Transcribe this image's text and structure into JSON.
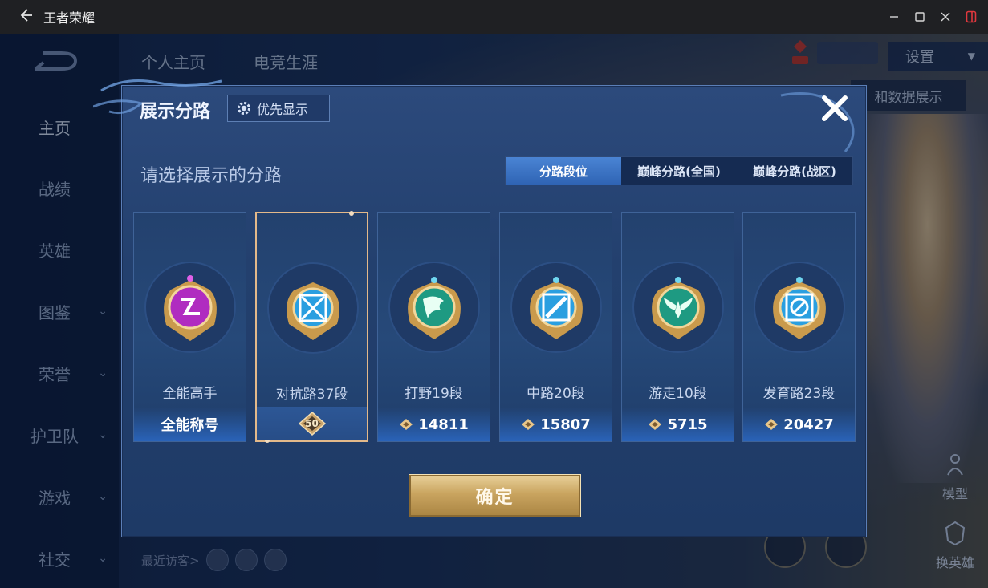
{
  "window": {
    "title": "王者荣耀",
    "back_icon": "arrow-left-icon",
    "controls": [
      "minimize-icon",
      "maximize-icon",
      "close-icon",
      "sidebar-toggle-icon"
    ],
    "accent_color": "#e0383e"
  },
  "left_nav": {
    "items": [
      {
        "label": "主页",
        "active": true,
        "chevron": false
      },
      {
        "label": "战绩",
        "active": false,
        "chevron": false
      },
      {
        "label": "英雄",
        "active": false,
        "chevron": false
      },
      {
        "label": "图鉴",
        "active": false,
        "chevron": true
      },
      {
        "label": "荣誉",
        "active": false,
        "chevron": true
      },
      {
        "label": "护卫队",
        "active": false,
        "chevron": true
      },
      {
        "label": "游戏",
        "active": false,
        "chevron": true
      },
      {
        "label": "社交",
        "active": false,
        "chevron": true
      }
    ]
  },
  "top_nav": {
    "tabs": [
      "个人主页",
      "电竞生涯"
    ],
    "settings_label": "设置",
    "right_banner": "和数据展示"
  },
  "side_buttons": {
    "model_label": "模型",
    "switch_hero_label": "换英雄"
  },
  "visitors": {
    "label": "最近访客>"
  },
  "modal": {
    "title": "展示分路",
    "priority_button": "优先显示",
    "prompt": "请选择展示的分路",
    "tabs": [
      {
        "label": "分路段位",
        "active": true
      },
      {
        "label": "巅峰分路(全国)",
        "active": false
      },
      {
        "label": "巅峰分路(战区)",
        "active": false
      }
    ],
    "cards": [
      {
        "lane": "全能高手",
        "footer": "全能称号",
        "score_icon": false,
        "selected": false,
        "medal_color": "#b02cc0",
        "emblem": "allround"
      },
      {
        "lane": "对抗路37段",
        "footer": "50",
        "score_icon": false,
        "selected": true,
        "medal_color": "#2a9fe0",
        "emblem": "swords"
      },
      {
        "lane": "打野19段",
        "footer": "14811",
        "score_icon": true,
        "selected": false,
        "medal_color": "#1e9a82",
        "emblem": "dragon"
      },
      {
        "lane": "中路20段",
        "footer": "15807",
        "score_icon": true,
        "selected": false,
        "medal_color": "#2a9fe0",
        "emblem": "staff"
      },
      {
        "lane": "游走10段",
        "footer": "5715",
        "score_icon": true,
        "selected": false,
        "medal_color": "#1e9a82",
        "emblem": "wings"
      },
      {
        "lane": "发育路23段",
        "footer": "20427",
        "score_icon": true,
        "selected": false,
        "medal_color": "#2a9fe0",
        "emblem": "shield"
      }
    ],
    "confirm_label": "确定"
  }
}
